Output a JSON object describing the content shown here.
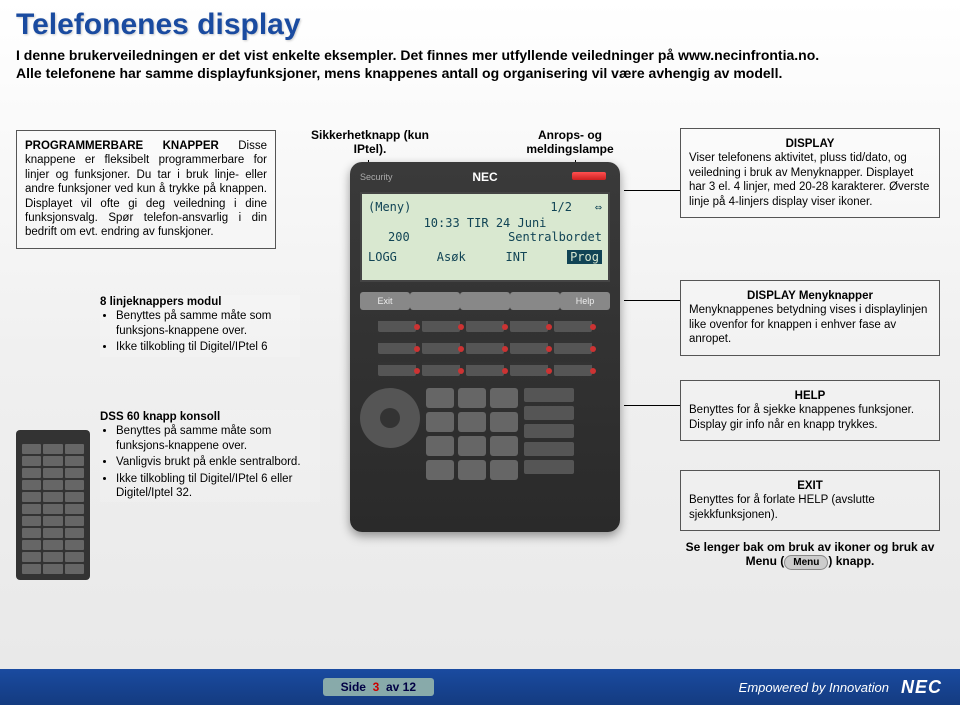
{
  "title": "Telefonenes display",
  "intro_line1": "I denne brukerveiledningen er det vist enkelte eksempler. Det finnes mer utfyllende veiledninger på ",
  "intro_link": "www.necinfrontia.no",
  "intro_dot": ".",
  "intro_line2": "Alle telefonene har samme displayfunksjoner, mens knappenes antall og organisering vil være avhengig av modell.",
  "box_prog": {
    "heading": "PROGRAMMERBARE KNAPPER",
    "body": " Disse knappene er fleksibelt programmerbare for linjer og funksjoner. Du tar i bruk linje- eller andre funksjoner ved kun å trykke på knappen. Displayet vil ofte gi deg veiledning i dine funksjonsvalg. Spør telefon-ansvarlig i din bedrift om evt. endring av funskjoner."
  },
  "mod8": {
    "heading": "8 linjeknappers modul",
    "items": [
      "Benyttes på samme måte som funksjons-knappene over.",
      "Ikke tilkobling til Digitel/IPtel 6"
    ]
  },
  "dss": {
    "heading": "DSS 60 knapp konsoll",
    "items": [
      "Benyttes på samme måte som funksjons-knappene over.",
      "Vanligvis brukt på enkle sentralbord.",
      "Ikke tilkobling til Digitel/IPtel 6 eller Digitel/Iptel 32."
    ]
  },
  "label_sikkerhet": "Sikkerhetknapp (kun IPtel).",
  "label_anrop": "Anrops- og meldingslampe",
  "lcd": {
    "row1a": "(Meny)",
    "row1b": "1/2",
    "row2": "10:33 TIR 24 Juni",
    "row3a": "200",
    "row3b": "Sentralbordet",
    "row4": [
      "LOGG",
      "Asøk",
      "INT",
      "Prog"
    ]
  },
  "softkeys": {
    "exit": "Exit",
    "help": "Help"
  },
  "brand": "NEC",
  "security_label": "Security",
  "box_display": {
    "heading": "DISPLAY",
    "body": "Viser telefonens aktivitet, pluss tid/dato, og veiledning i bruk av Menyknapper. Displayet har 3 el. 4 linjer, med 20-28 karakterer. Øverste linje på 4-linjers display viser ikoner."
  },
  "box_menyk": {
    "heading": "DISPLAY Menyknapper",
    "body": "Menyknappenes betydning vises i displaylinjen like ovenfor for knappen i enhver fase av anropet."
  },
  "box_help": {
    "heading": "HELP",
    "body": "Benyttes for å sjekke knappenes funksjoner. Display gir info når en knapp trykkes."
  },
  "box_exit": {
    "heading": "EXIT",
    "body": "Benyttes for å forlate HELP (avslutte sjekkfunksjonen)."
  },
  "see_more_a": "Se lenger bak om bruk av ikoner og bruk av Menu (",
  "menu_pill": "Menu",
  "see_more_b": ") knapp.",
  "footer": {
    "side": "Side",
    "page": "3",
    "of": "av 12",
    "slogan": "Empowered by Innovation",
    "brand": "NEC"
  }
}
